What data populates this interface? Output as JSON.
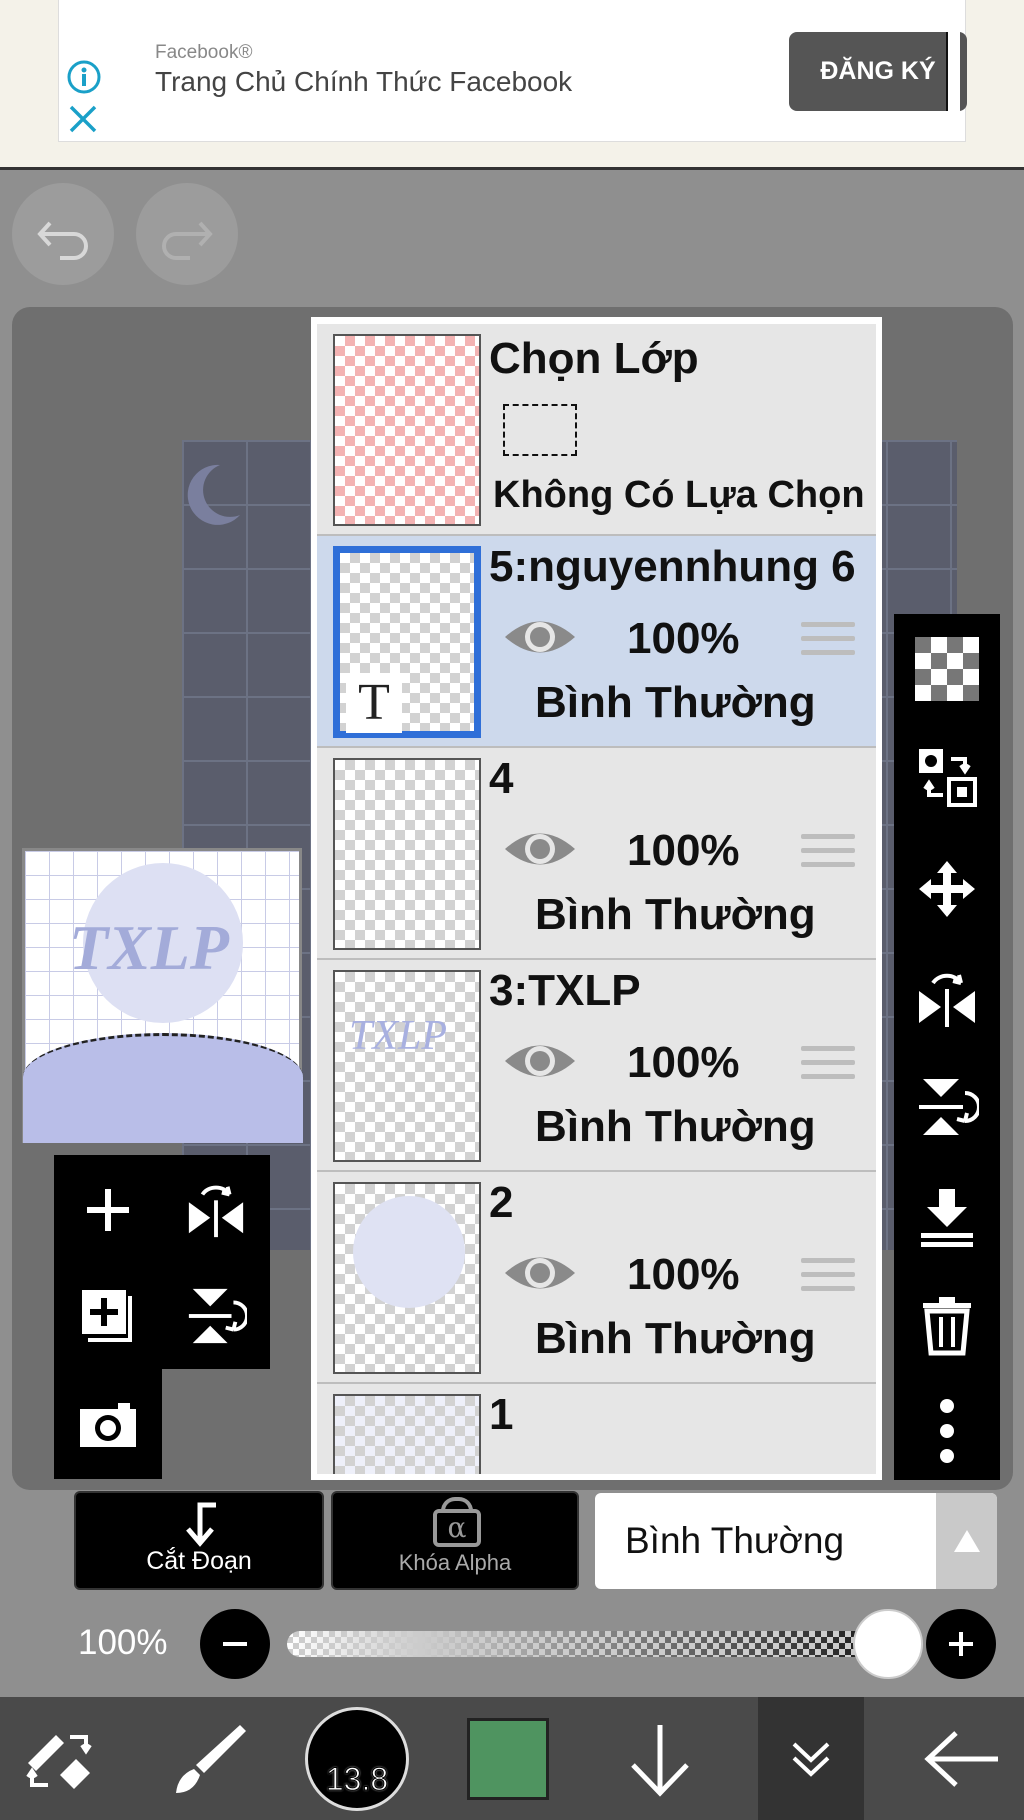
{
  "ad": {
    "brand": "Facebook®",
    "title": "Trang Chủ Chính Thức Facebook",
    "cta": "ĐĂNG KÝ"
  },
  "layers_panel": {
    "selection_layer": {
      "title": "Chọn Lớp",
      "status": "Không Có Lựa Chọn"
    },
    "layers": [
      {
        "name": "5:nguyennhung 6",
        "opacity": "100%",
        "blend": "Bình Thường",
        "selected": true,
        "thumb_text": "T"
      },
      {
        "name": "4",
        "opacity": "100%",
        "blend": "Bình Thường",
        "selected": false
      },
      {
        "name": "3:TXLP",
        "opacity": "100%",
        "blend": "Bình Thường",
        "selected": false,
        "thumb_text": "TXLP"
      },
      {
        "name": "2",
        "opacity": "100%",
        "blend": "Bình Thường",
        "selected": false
      },
      {
        "name": "1"
      }
    ]
  },
  "preview": {
    "art_text": "TXLP"
  },
  "bottom_controls": {
    "clip_label": "Cắt Đoạn",
    "alpha_lock_label": "Khóa Alpha",
    "alpha_symbol": "α",
    "blend_mode": "Bình Thường"
  },
  "opacity_control": {
    "value_label": "100%",
    "level": 1.0
  },
  "toolbar": {
    "brush_size": "13.8",
    "color": "#4f9460"
  },
  "icons": {
    "ad_info": "info-icon",
    "ad_close": "close-icon",
    "undo": "undo-icon",
    "redo": "redo-icon",
    "right_toolbar": [
      "transparency-icon",
      "layer-swap-icon",
      "move-icon",
      "flip-horizontal-icon",
      "flip-vertical-icon",
      "merge-down-icon",
      "trash-icon",
      "more-icon"
    ],
    "left_toolbar": [
      "add-layer-icon",
      "flip-h-icon",
      "add-copy-icon",
      "flip-v-icon",
      "camera-icon"
    ],
    "bottom_toolbar": [
      "tool-switch-icon",
      "brush-icon",
      "brush-size-icon",
      "color-swatch",
      "arrow-down-icon",
      "collapse-icon",
      "back-arrow-icon"
    ]
  }
}
